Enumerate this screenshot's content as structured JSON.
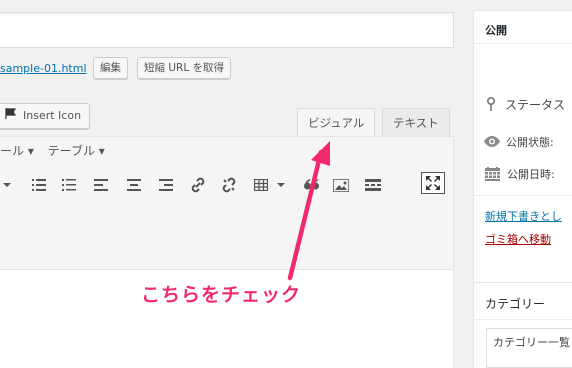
{
  "editor": {
    "permalink_text": "sample-01.html",
    "edit_button": "編集",
    "shortlink_button": "短縮 URL を取得",
    "insert_icon_button": "Insert Icon",
    "tab_visual": "ビジュアル",
    "tab_text": "テキスト",
    "menu_items": [
      "ール ▾",
      "テーブル ▾"
    ]
  },
  "sidebar": {
    "publish_title": "公開",
    "status_label": "ステータス",
    "visibility_label": "公開状態: ",
    "date_label": "公開日時: ",
    "save_draft_link": "新規下書きとし",
    "trash_link": "ゴミ箱へ移動",
    "category_title": "カテゴリー",
    "category_tab": "カテゴリー一覧"
  },
  "annotation": {
    "text": "こちらをチェック",
    "color": "#f2296e"
  },
  "colors": {
    "link": "#0073aa",
    "trash": "#aa0000",
    "background": "#f1f1f1"
  }
}
